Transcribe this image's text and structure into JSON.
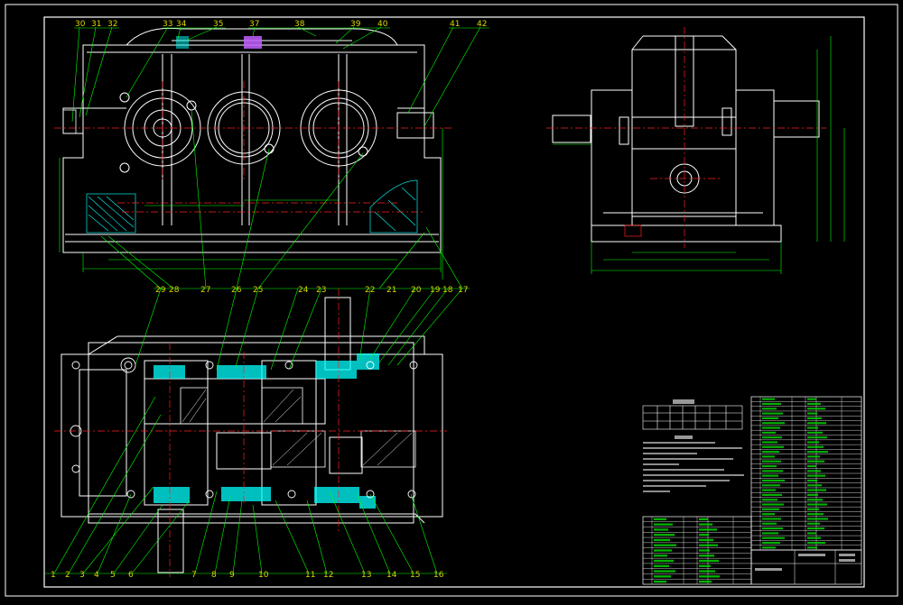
{
  "balloons_top": [
    "30",
    "31",
    "32",
    "33",
    "34",
    "35",
    "37",
    "38",
    "39",
    "40",
    "41",
    "42"
  ],
  "balloons_mid": [
    "29",
    "28",
    "27",
    "26",
    "25",
    "24",
    "23",
    "22",
    "21",
    "20",
    "19",
    "18",
    "17"
  ],
  "balloons_bottom": [
    "1",
    "2",
    "3",
    "4",
    "5",
    "6",
    "7",
    "8",
    "9",
    "10",
    "11",
    "12",
    "13",
    "14",
    "15",
    "16"
  ],
  "colors": {
    "background": "#000000",
    "outline": "#ffffff",
    "centerline": "#ff2020",
    "dimension": "#00ff00",
    "section": "#00ffff",
    "leader": "#00ff00",
    "balloon": "#d8d800",
    "hidden": "#ffff00"
  }
}
